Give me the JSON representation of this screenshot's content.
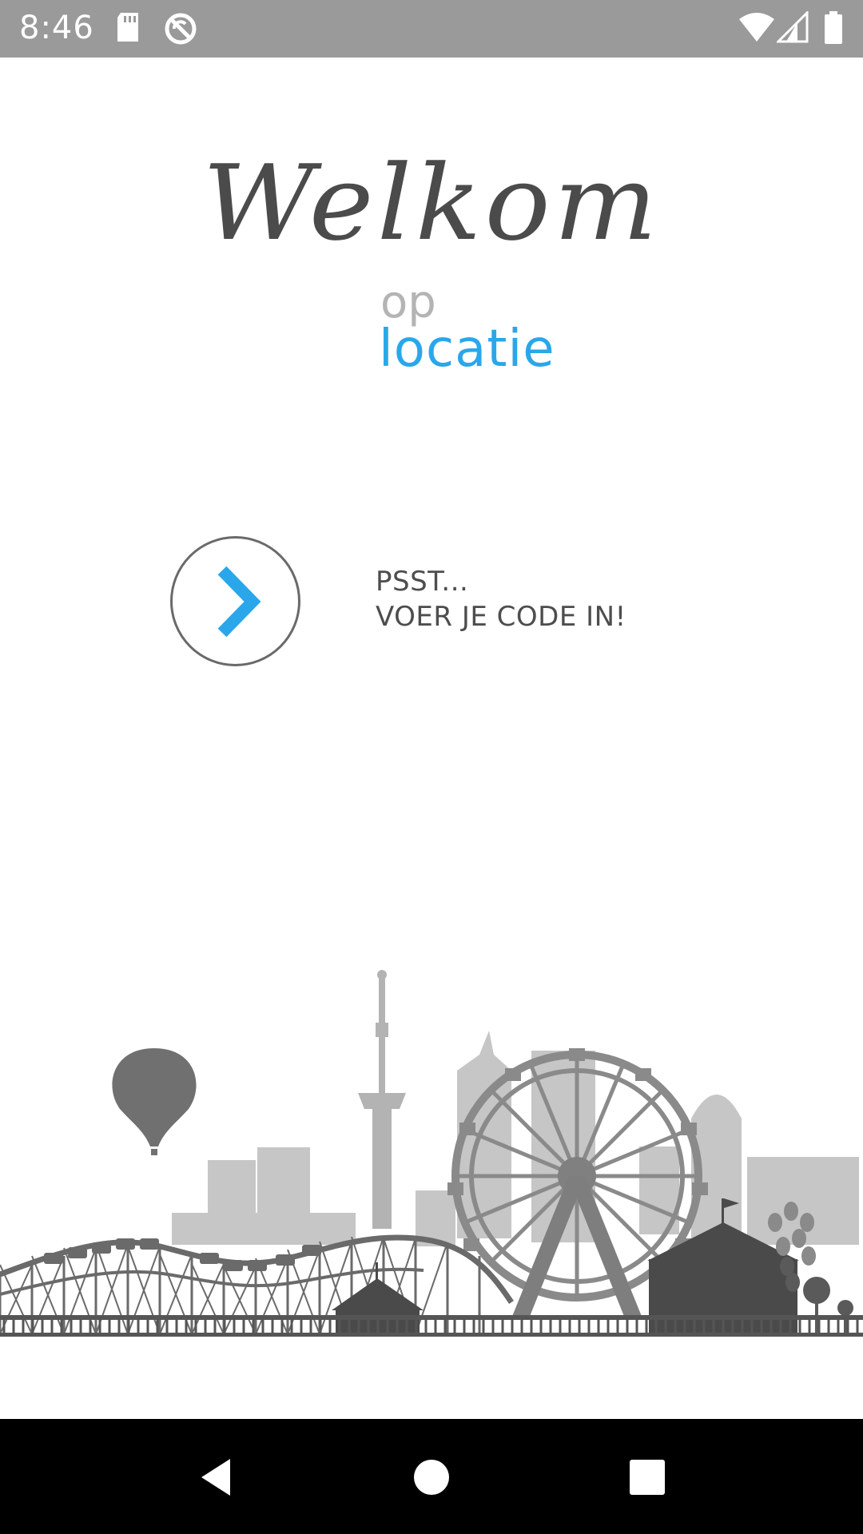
{
  "status_bar": {
    "time": "8:46",
    "left_icons": [
      "sd-card-icon",
      "no-sync-icon"
    ],
    "right_icons": [
      "wifi-icon",
      "signal-icon",
      "battery-icon"
    ]
  },
  "welcome": {
    "title": "Welkom",
    "logo_top": "op",
    "logo_bottom": "locatie"
  },
  "code_prompt": {
    "button_icon": "chevron-right-icon",
    "line1": "PSST...",
    "line2": "VOER JE CODE IN!"
  },
  "illustration": {
    "name": "amusement-park-skyline"
  },
  "nav_bar": {
    "buttons": [
      "back-icon",
      "home-icon",
      "recents-icon"
    ]
  },
  "colors": {
    "status_bar": "#9a9a9a",
    "accent_blue": "#2aa7ea",
    "title_gray": "#4b4b4b",
    "nav_bar": "#000000"
  }
}
